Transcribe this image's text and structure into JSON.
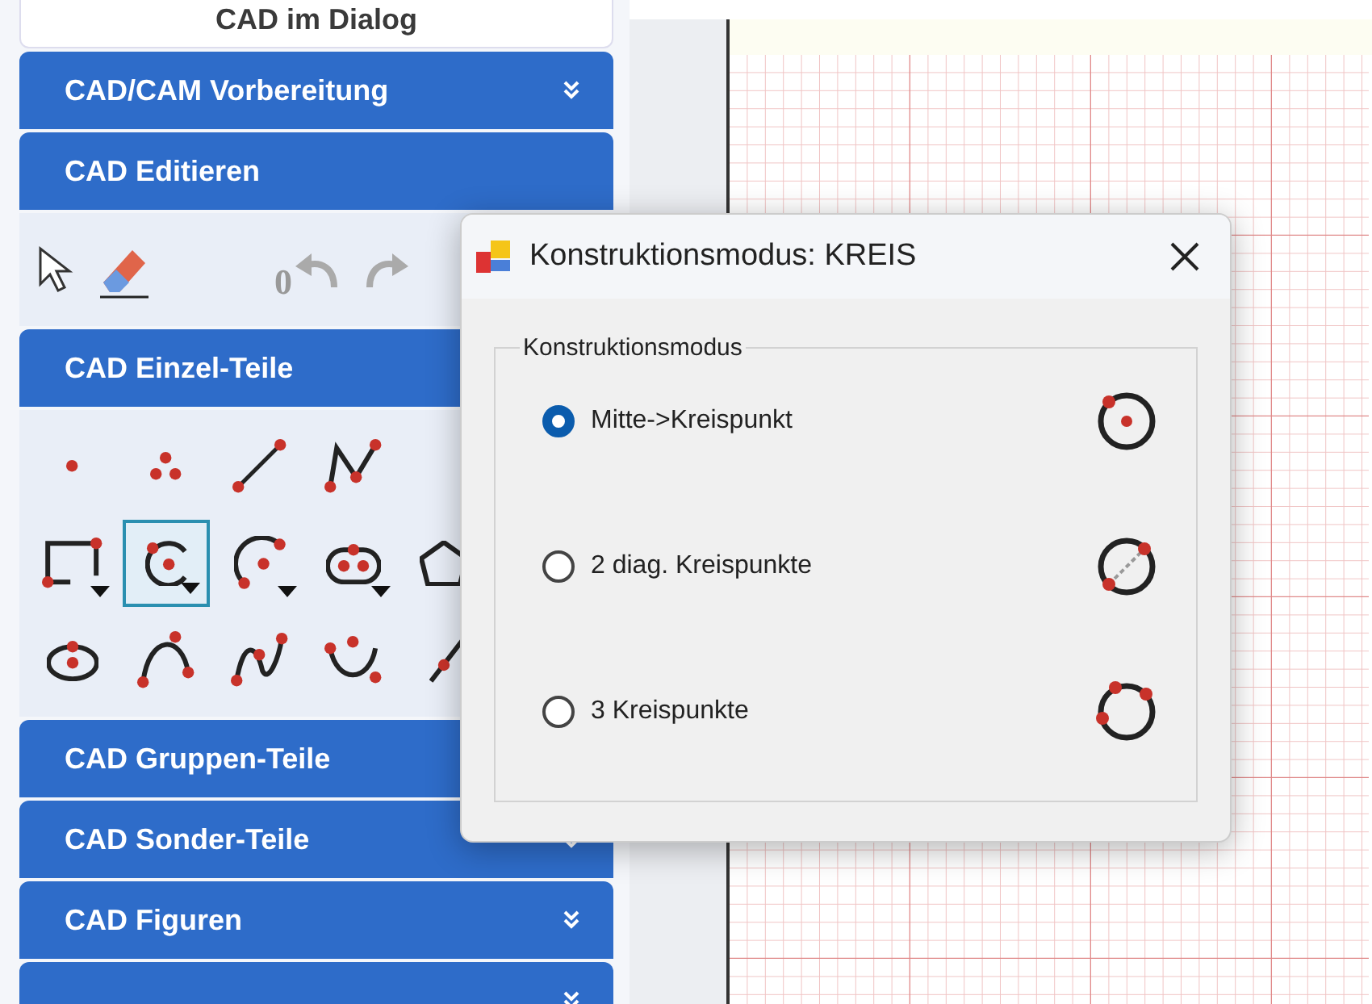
{
  "sidebar": {
    "top_button": "CAD im Dialog",
    "sections": [
      {
        "title": "CAD/CAM Vorbereitung",
        "expanded": false
      },
      {
        "title": "CAD Editieren",
        "expanded": true,
        "kind": "edit"
      },
      {
        "title": "CAD Einzel-Teile",
        "expanded": true,
        "kind": "tools"
      },
      {
        "title": "CAD Gruppen-Teile",
        "expanded": false
      },
      {
        "title": "CAD Sonder-Teile",
        "expanded": false
      },
      {
        "title": "CAD Figuren",
        "expanded": false
      },
      {
        "expanded": false
      }
    ],
    "edit_tools": {
      "undo_count": "0"
    },
    "tools": [
      {
        "kind": "point",
        "selected": false
      },
      {
        "kind": "points",
        "selected": false
      },
      {
        "kind": "line",
        "selected": false
      },
      {
        "kind": "polyline",
        "selected": false
      },
      {
        "kind": "none"
      },
      {
        "kind": "rectangle",
        "selected": false,
        "dropdown": true
      },
      {
        "kind": "circle",
        "selected": true,
        "dropdown": true
      },
      {
        "kind": "arc",
        "selected": false,
        "dropdown": true
      },
      {
        "kind": "slot",
        "selected": false,
        "dropdown": true
      },
      {
        "kind": "polygon",
        "selected": false
      },
      {
        "kind": "ellipse",
        "selected": false
      },
      {
        "kind": "curve",
        "selected": false
      },
      {
        "kind": "spline",
        "selected": false
      },
      {
        "kind": "wave",
        "selected": false
      },
      {
        "kind": "tangent",
        "selected": false
      }
    ]
  },
  "dialog": {
    "title": "Konstruktionsmodus: KREIS",
    "group_label": "Konstruktionsmodus",
    "options": [
      {
        "label": "Mitte->Kreispunkt",
        "selected": true,
        "kind": "center"
      },
      {
        "label": "2 diag. Kreispunkte",
        "selected": false,
        "kind": "diagonal"
      },
      {
        "label": "3 Kreispunkte",
        "selected": false,
        "kind": "three"
      }
    ]
  }
}
